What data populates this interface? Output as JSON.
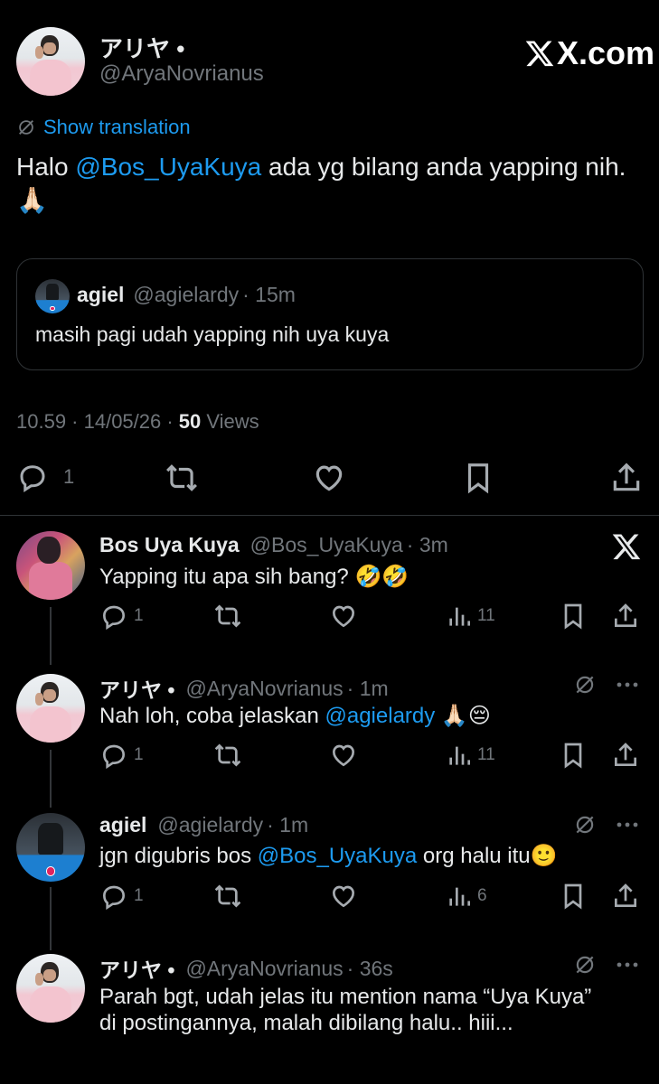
{
  "main_tweet": {
    "display_name": "アリヤ •",
    "handle": "@AryaNovrianus",
    "brand": "X.com",
    "show_translation": "Show translation",
    "text_prefix": "Halo ",
    "text_mention": "@Bos_UyaKuya",
    "text_suffix": " ada yg bilang anda yapping nih. 🙏🏻",
    "quote": {
      "name": "agiel",
      "handle": "@agielardy",
      "time": "· 15m",
      "text": "masih pagi udah yapping nih uya kuya"
    },
    "timestamp": "10.59 · 14/05/26 · ",
    "views_count": "50",
    "views_label": " Views",
    "reply_count": "1"
  },
  "replies": [
    {
      "name": "Bos Uya Kuya",
      "handle": "@Bos_UyaKuya",
      "time": "· 3m",
      "text": "Yapping itu apa sih bang? 🤣🤣",
      "reply_count": "1",
      "views": "11"
    },
    {
      "name": "アリヤ •",
      "handle": "@AryaNovrianus",
      "time": "· 1m",
      "text_prefix": "Nah loh, coba jelaskan ",
      "text_mention": "@agielardy",
      "text_suffix": " 🙏🏻😔",
      "reply_count": "1",
      "views": "11"
    },
    {
      "name": "agiel",
      "handle": "@agielardy",
      "time": "· 1m",
      "text_prefix": "jgn digubris bos ",
      "text_mention": "@Bos_UyaKuya",
      "text_suffix": " org halu itu🙂",
      "reply_count": "1",
      "views": "6"
    },
    {
      "name": "アリヤ •",
      "handle": "@AryaNovrianus",
      "time": "· 36s",
      "text": "Parah bgt, udah jelas itu mention nama “Uya Kuya” di postingannya, malah dibilang halu.. hiii..."
    }
  ],
  "colors": {
    "background": "#000000",
    "text": "#e7e9ea",
    "muted": "#71767b",
    "link": "#1d9bf0",
    "border": "#2f3336"
  },
  "icons": [
    "reply-icon",
    "retweet-icon",
    "like-icon",
    "bookmark-icon",
    "share-icon",
    "views-icon",
    "x-logo-icon",
    "translate-icon",
    "more-icon"
  ]
}
